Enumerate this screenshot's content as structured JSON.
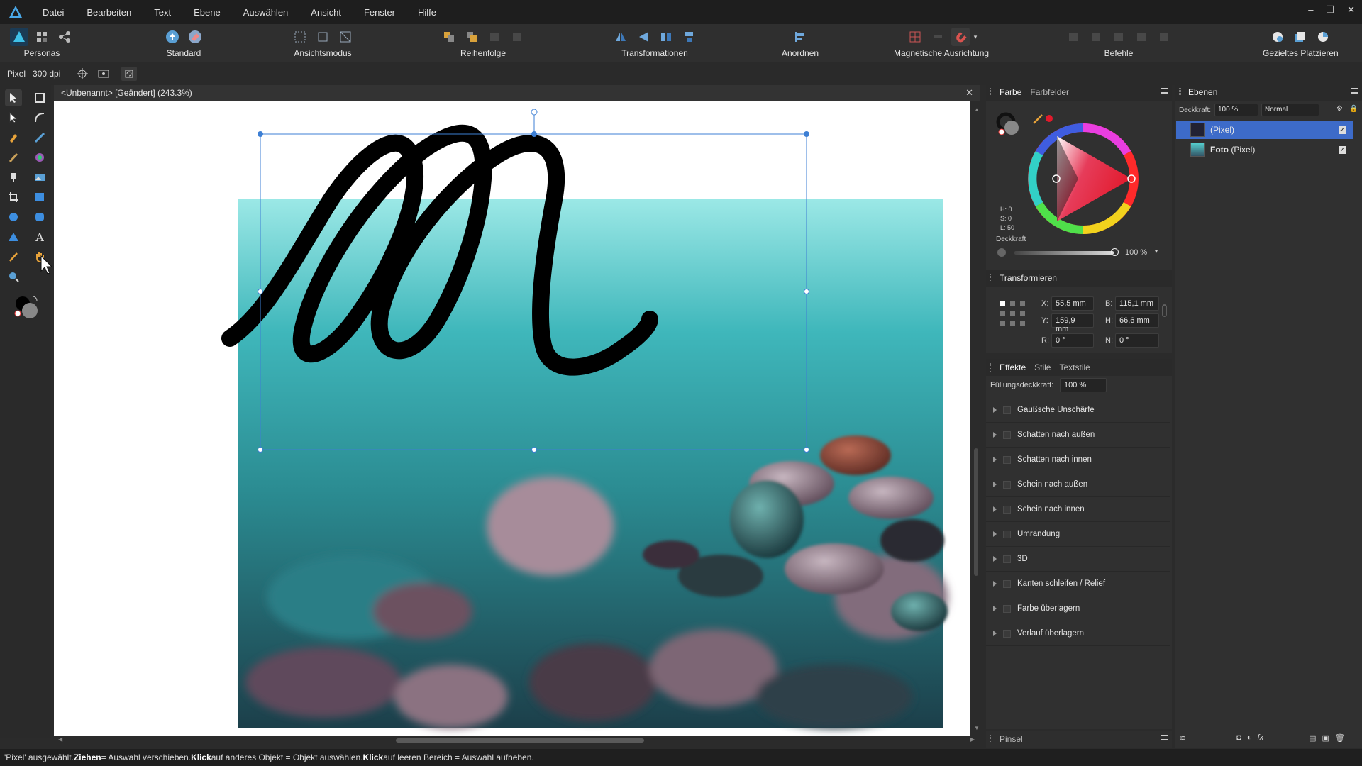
{
  "menubar": {
    "items": [
      "Datei",
      "Bearbeiten",
      "Text",
      "Ebene",
      "Auswählen",
      "Ansicht",
      "Fenster",
      "Hilfe"
    ],
    "window_controls": [
      "–",
      "❐",
      "✕"
    ]
  },
  "toolbar": {
    "personas_label": "Personas",
    "standard_label": "Standard",
    "ansichtsmodus_label": "Ansichtsmodus",
    "reihenfolge_label": "Reihenfolge",
    "transformationen_label": "Transformationen",
    "anordnen_label": "Anordnen",
    "magnetische_label": "Magnetische Ausrichtung",
    "befehle_label": "Befehle",
    "gezieltes_label": "Gezieltes Platzieren"
  },
  "contextbar": {
    "unit": "Pixel",
    "dpi": "300 dpi"
  },
  "document": {
    "title": "<Unbenannt> [Geändert] (243.3%)",
    "close": "✕"
  },
  "color_panel": {
    "tabs": [
      "Farbe",
      "Farbfelder"
    ],
    "hsl": {
      "h": "H: 0",
      "s": "S: 0",
      "l": "L: 50"
    },
    "opacity_label": "Deckkraft",
    "opacity_value": "100 %",
    "accent": "#e21a2c"
  },
  "transform_panel": {
    "tab": "Transformieren",
    "x_label": "X:",
    "x_value": "55,5 mm",
    "y_label": "Y:",
    "y_value": "159,9 mm",
    "b_label": "B:",
    "b_value": "115,1 mm",
    "h_label": "H:",
    "h_value": "66,6 mm",
    "r_label": "R:",
    "r_value": "0 °",
    "n_label": "N:",
    "n_value": "0 °"
  },
  "effects_panel": {
    "tabs": [
      "Effekte",
      "Stile",
      "Textstile"
    ],
    "fill_label": "Füllungsdeckkraft:",
    "fill_value": "100 %",
    "effects": [
      "Gaußsche Unschärfe",
      "Schatten nach außen",
      "Schatten nach innen",
      "Schein nach außen",
      "Schein nach innen",
      "Umrandung",
      "3D",
      "Kanten schleifen / Relief",
      "Farbe überlagern",
      "Verlauf überlagern"
    ]
  },
  "brush_panel": {
    "tab": "Pinsel"
  },
  "layers_panel": {
    "tab": "Ebenen",
    "opacity_label": "Deckkraft:",
    "opacity_value": "100 %",
    "blend_mode": "Normal",
    "layers": [
      {
        "name": "",
        "type": "(Pixel)",
        "selected": true
      },
      {
        "name": "Foto",
        "type": "(Pixel)",
        "selected": false
      }
    ],
    "selection_color": "#3d6bc9"
  },
  "statusbar": {
    "p1": "'Pixel' ausgewählt. ",
    "b1": "Ziehen",
    "p2": " = Auswahl verschieben. ",
    "b2": "Klick",
    "p3": " auf anderes Objekt = Objekt auswählen. ",
    "b3": "Klick",
    "p4": " auf leeren Bereich = Auswahl aufheben."
  }
}
